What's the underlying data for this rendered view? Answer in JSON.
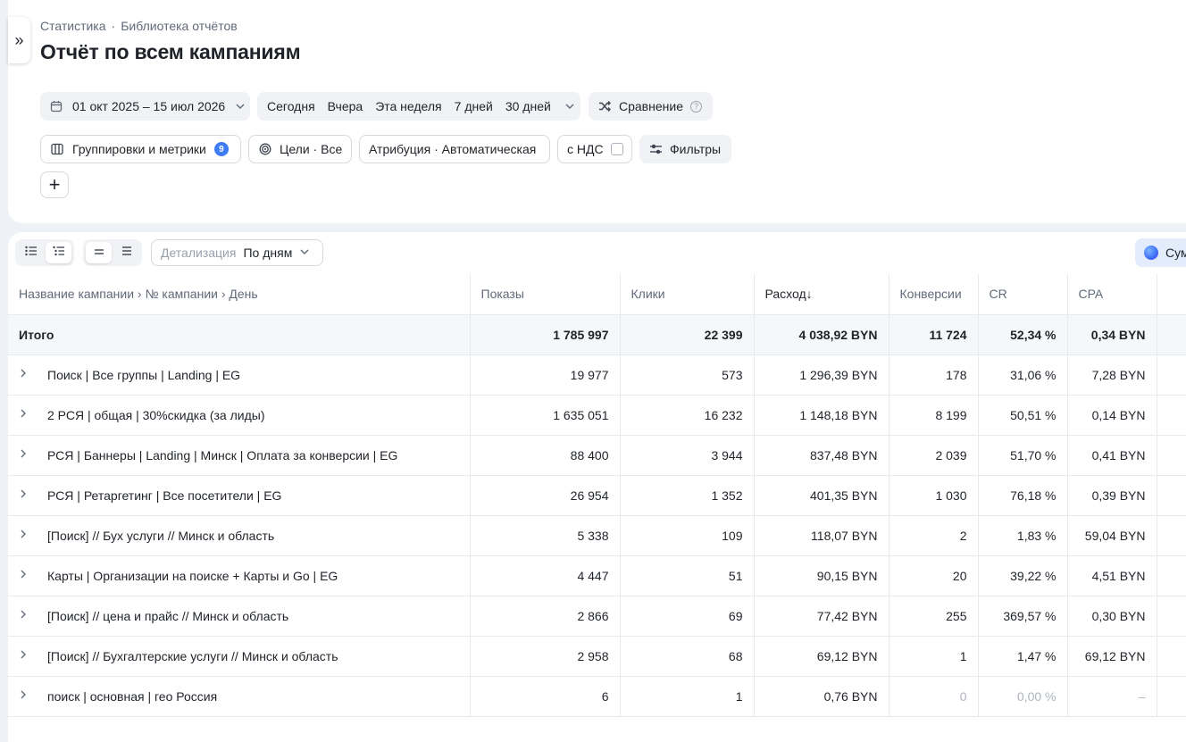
{
  "breadcrumb": [
    "Статистика",
    "Библиотека отчётов"
  ],
  "breadcrumb_separator": "·",
  "page_title": "Отчёт по всем кампаниям",
  "side_toggle": "»",
  "date_range": "01 окт 2025 – 15 июл 2026",
  "periods": [
    "Сегодня",
    "Вчера",
    "Эта неделя",
    "7 дней",
    "30 дней"
  ],
  "compare_label": "Сравнение",
  "filters": {
    "groupings_label": "Группировки и метрики",
    "groupings_count": "9",
    "goals_label": "Цели · Все",
    "attribution_label": "Атрибуция · Автоматическая",
    "vat_label": "с НДС",
    "filters_label": "Фильтры",
    "add_label": "+"
  },
  "toolbar": {
    "detail_label": "Детализация",
    "detail_value": "По дням",
    "sum_label": "Сум"
  },
  "table": {
    "headers": [
      "Название кампании › № кампании › День",
      "Показы",
      "Клики",
      "Расход",
      "Конверсии",
      "CR",
      "CPA"
    ],
    "sort_indicator": "↓",
    "total": [
      "Итого",
      "1 785 997",
      "22 399",
      "4 038,92 BYN",
      "11 724",
      "52,34 %",
      "0,34 BYN"
    ],
    "rows": [
      [
        "Поиск | Все группы | Landing | EG",
        "19 977",
        "573",
        "1 296,39 BYN",
        "178",
        "31,06 %",
        "7,28 BYN"
      ],
      [
        "2 РСЯ | общая | 30%скидка (за лиды)",
        "1 635 051",
        "16 232",
        "1 148,18 BYN",
        "8 199",
        "50,51 %",
        "0,14 BYN"
      ],
      [
        "РСЯ | Баннеры | Landing | Минск | Оплата за конверсии | EG",
        "88 400",
        "3 944",
        "837,48 BYN",
        "2 039",
        "51,70 %",
        "0,41 BYN"
      ],
      [
        "РСЯ | Ретаргетинг | Все посетители | EG",
        "26 954",
        "1 352",
        "401,35 BYN",
        "1 030",
        "76,18 %",
        "0,39 BYN"
      ],
      [
        "[Поиск] // Бух услуги // Минск и область",
        "5 338",
        "109",
        "118,07 BYN",
        "2",
        "1,83 %",
        "59,04 BYN"
      ],
      [
        "Карты | Организации на поиске + Карты и Go | EG",
        "4 447",
        "51",
        "90,15 BYN",
        "20",
        "39,22 %",
        "4,51 BYN"
      ],
      [
        "[Поиск] // цена и прайс // Минск и область",
        "2 866",
        "69",
        "77,42 BYN",
        "255",
        "369,57 %",
        "0,30 BYN"
      ],
      [
        "[Поиск] // Бухгалтерские услуги // Минск и область",
        "2 958",
        "68",
        "69,12 BYN",
        "1",
        "1,47 %",
        "69,12 BYN"
      ],
      [
        "поиск | основная | гео Россия",
        "6",
        "1",
        "0,76 BYN",
        "0",
        "0,00 %",
        "–"
      ]
    ]
  }
}
